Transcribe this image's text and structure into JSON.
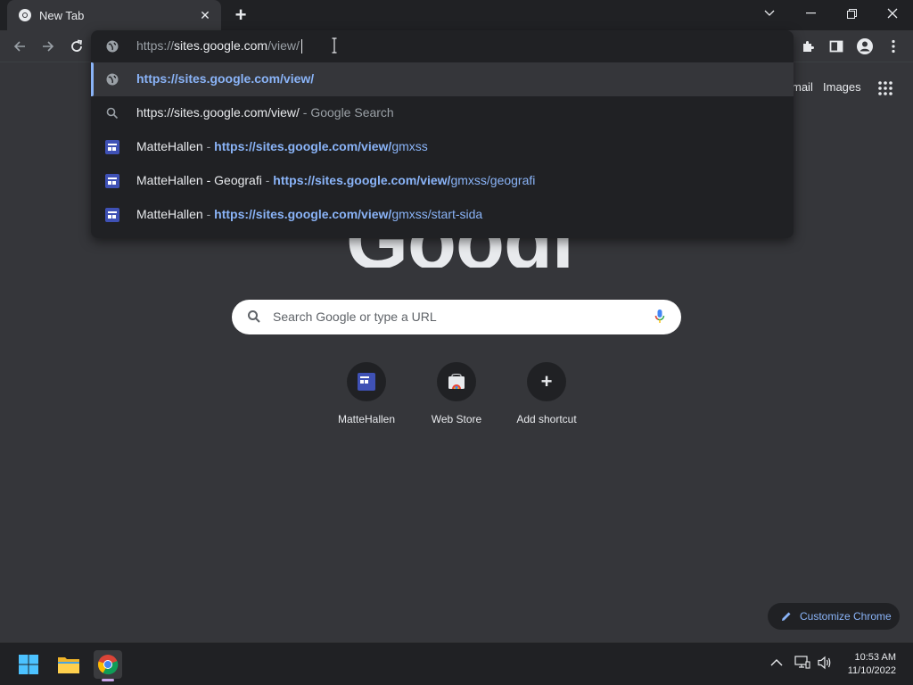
{
  "browser": {
    "tab_title": "New Tab",
    "new_tab_symbol": "+",
    "tab_close_symbol": "✕"
  },
  "omnibox": {
    "value_scheme": "https://",
    "value_host": "sites.google.com",
    "value_path": "/view/"
  },
  "suggestions": [
    {
      "icon": "globe-icon",
      "parts": [
        {
          "text": "https://sites.google.com/view/",
          "style": "blue-b"
        }
      ]
    },
    {
      "icon": "search-icon",
      "parts": [
        {
          "text": "https://sites.google.com/view/",
          "style": ""
        },
        {
          "text": " - Google Search",
          "style": "grey"
        }
      ]
    },
    {
      "icon": "google-sites-icon",
      "parts": [
        {
          "text": "MatteHallen",
          "style": ""
        },
        {
          "text": " - ",
          "style": "grey"
        },
        {
          "text": "https://sites.google.com/view/",
          "style": "blue-b"
        },
        {
          "text": "gmxss",
          "style": "blue"
        }
      ]
    },
    {
      "icon": "google-sites-icon",
      "parts": [
        {
          "text": "MatteHallen - Geografi",
          "style": ""
        },
        {
          "text": " - ",
          "style": "grey"
        },
        {
          "text": "https://sites.google.com/view/",
          "style": "blue-b"
        },
        {
          "text": "gmxss/geografi",
          "style": "blue"
        }
      ]
    },
    {
      "icon": "google-sites-icon",
      "parts": [
        {
          "text": "MatteHallen",
          "style": ""
        },
        {
          "text": " - ",
          "style": "grey"
        },
        {
          "text": "https://sites.google.com/view/",
          "style": "blue-b"
        },
        {
          "text": "gmxss/start-sida",
          "style": "blue"
        }
      ]
    }
  ],
  "ntp": {
    "gmail_link": "mail",
    "images_link": "Images",
    "logo_text": "Google",
    "search_placeholder": "Search Google or type a URL",
    "shortcuts": [
      {
        "label": "MatteHallen",
        "icon": "google-sites-icon"
      },
      {
        "label": "Web Store",
        "icon": "web-store-icon"
      },
      {
        "label": "Add shortcut",
        "icon": "plus-icon",
        "symbol": "+"
      }
    ],
    "customize_label": "Customize Chrome"
  },
  "taskbar": {
    "time": "10:53 AM",
    "date": "11/10/2022"
  },
  "colors": {
    "accent": "#8ab4f8",
    "background": "#35363a",
    "dropdown": "#202124"
  }
}
